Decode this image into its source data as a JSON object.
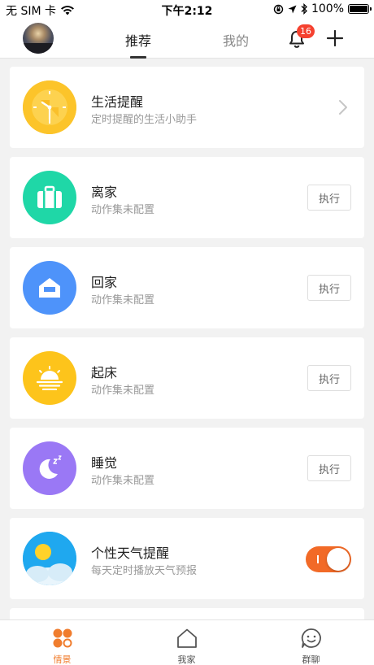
{
  "status_bar": {
    "carrier": "无 SIM 卡",
    "time": "下午2:12",
    "battery": "100%"
  },
  "header": {
    "tabs": [
      {
        "label": "推荐",
        "active": true
      },
      {
        "label": "我的",
        "active": false
      }
    ],
    "notification_count": "16"
  },
  "cards": [
    {
      "title": "生活提醒",
      "subtitle": "定时提醒的生活小助手",
      "action": "chevron",
      "icon": "clock-icon",
      "color": "#fcc42a"
    },
    {
      "title": "离家",
      "subtitle": "动作集未配置",
      "action": "执行",
      "icon": "suitcase-icon",
      "color": "#1fd7a7"
    },
    {
      "title": "回家",
      "subtitle": "动作集未配置",
      "action": "执行",
      "icon": "house-icon",
      "color": "#4e93fa"
    },
    {
      "title": "起床",
      "subtitle": "动作集未配置",
      "action": "执行",
      "icon": "sunrise-icon",
      "color": "#fdc41b"
    },
    {
      "title": "睡觉",
      "subtitle": "动作集未配置",
      "action": "执行",
      "icon": "moon-icon",
      "color": "#9a78f5"
    },
    {
      "title": "个性天气提醒",
      "subtitle": "每天定时播放天气预报",
      "action": "toggle",
      "toggle_on": true,
      "icon": "weather-icon",
      "color": "#1fa8ef"
    }
  ],
  "tabbar": {
    "items": [
      {
        "label": "情景",
        "icon": "scenes-icon",
        "active": true
      },
      {
        "label": "我家",
        "icon": "home-icon",
        "active": false
      },
      {
        "label": "群聊",
        "icon": "chat-icon",
        "active": false
      }
    ]
  },
  "colors": {
    "accent": "#f07d2e",
    "badge": "#f5412f",
    "toggle_on": "#f26a27"
  }
}
